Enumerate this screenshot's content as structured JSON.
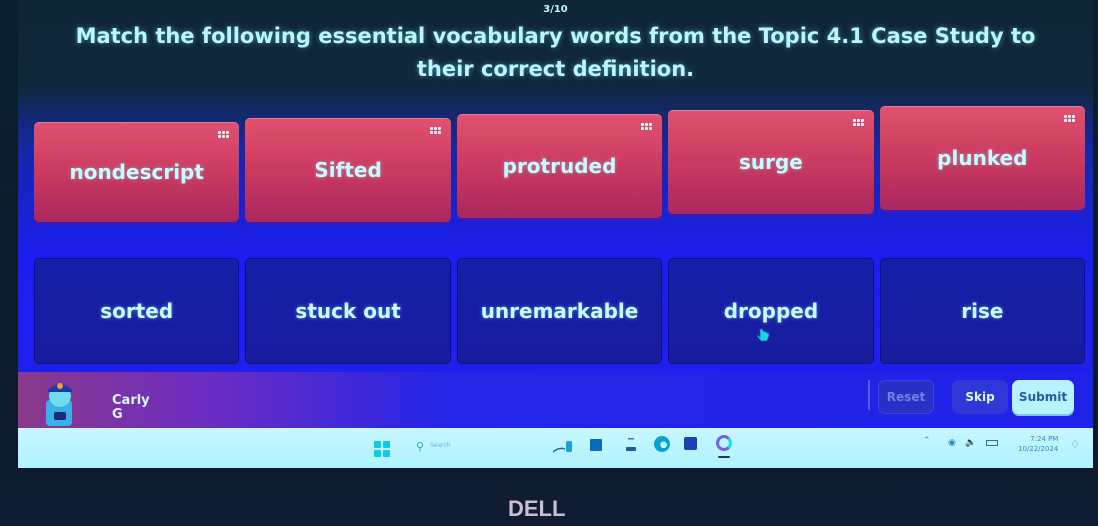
{
  "quiz": {
    "progress": "3/10",
    "prompt": "Match the following essential vocabulary words from the Topic 4.1 Case Study to their correct definition."
  },
  "terms": [
    {
      "label": "nondescript",
      "icon": "drag-handle-icon"
    },
    {
      "label": "Sifted",
      "icon": "drag-handle-icon"
    },
    {
      "label": "protruded",
      "icon": "drag-handle-icon"
    },
    {
      "label": "surge",
      "icon": "drag-handle-icon"
    },
    {
      "label": "plunked",
      "icon": "drag-handle-icon"
    }
  ],
  "definitions": [
    {
      "label": "sorted"
    },
    {
      "label": "stuck out"
    },
    {
      "label": "unremarkable"
    },
    {
      "label": "dropped"
    },
    {
      "label": "rise"
    }
  ],
  "player": {
    "name_line1": "Carly",
    "name_line2": "G"
  },
  "controls": {
    "reset_label": "Reset",
    "skip_label": "Skip",
    "submit_label": "Submit"
  },
  "taskbar": {
    "search_placeholder": "Search",
    "time": "7:24 PM",
    "date": "10/22/2024"
  },
  "device": {
    "brand": "DELL"
  },
  "colors": {
    "term_card": "#d0405f",
    "definition_card": "#1a1ca0",
    "text_cyan": "#c8fbff",
    "submit_bg": "#b8f1ff"
  }
}
